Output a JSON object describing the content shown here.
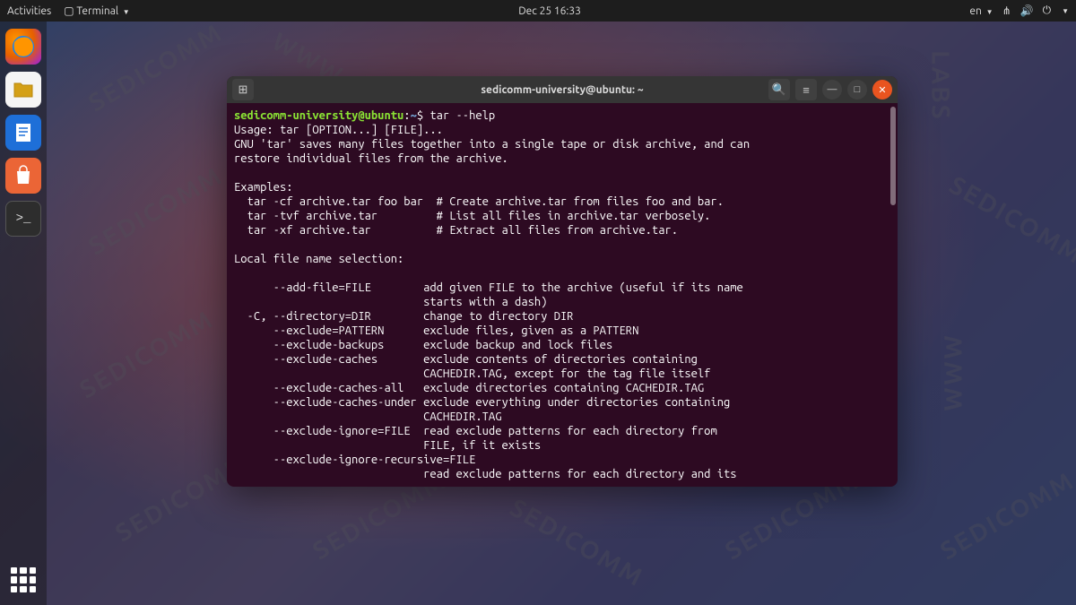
{
  "topbar": {
    "activities": "Activities",
    "terminal_menu": "Terminal",
    "datetime": "Dec 25  16:33",
    "lang": "en"
  },
  "dock": {
    "items": [
      "firefox",
      "files",
      "writer",
      "software",
      "terminal"
    ]
  },
  "window": {
    "title": "sedicomm-university@ubuntu: ~"
  },
  "prompt": {
    "user_host": "sedicomm-university@ubuntu",
    "path": "~",
    "symbol": "$",
    "command": "tar --help"
  },
  "output_lines": [
    "Usage: tar [OPTION...] [FILE]...",
    "GNU 'tar' saves many files together into a single tape or disk archive, and can",
    "restore individual files from the archive.",
    "",
    "Examples:",
    "  tar -cf archive.tar foo bar  # Create archive.tar from files foo and bar.",
    "  tar -tvf archive.tar         # List all files in archive.tar verbosely.",
    "  tar -xf archive.tar          # Extract all files from archive.tar.",
    "",
    "Local file name selection:",
    "",
    "      --add-file=FILE        add given FILE to the archive (useful if its name",
    "                             starts with a dash)",
    "  -C, --directory=DIR        change to directory DIR",
    "      --exclude=PATTERN      exclude files, given as a PATTERN",
    "      --exclude-backups      exclude backup and lock files",
    "      --exclude-caches       exclude contents of directories containing",
    "                             CACHEDIR.TAG, except for the tag file itself",
    "      --exclude-caches-all   exclude directories containing CACHEDIR.TAG",
    "      --exclude-caches-under exclude everything under directories containing",
    "                             CACHEDIR.TAG",
    "      --exclude-ignore=FILE  read exclude patterns for each directory from",
    "                             FILE, if it exists",
    "      --exclude-ignore-recursive=FILE",
    "                             read exclude patterns for each directory and its"
  ]
}
